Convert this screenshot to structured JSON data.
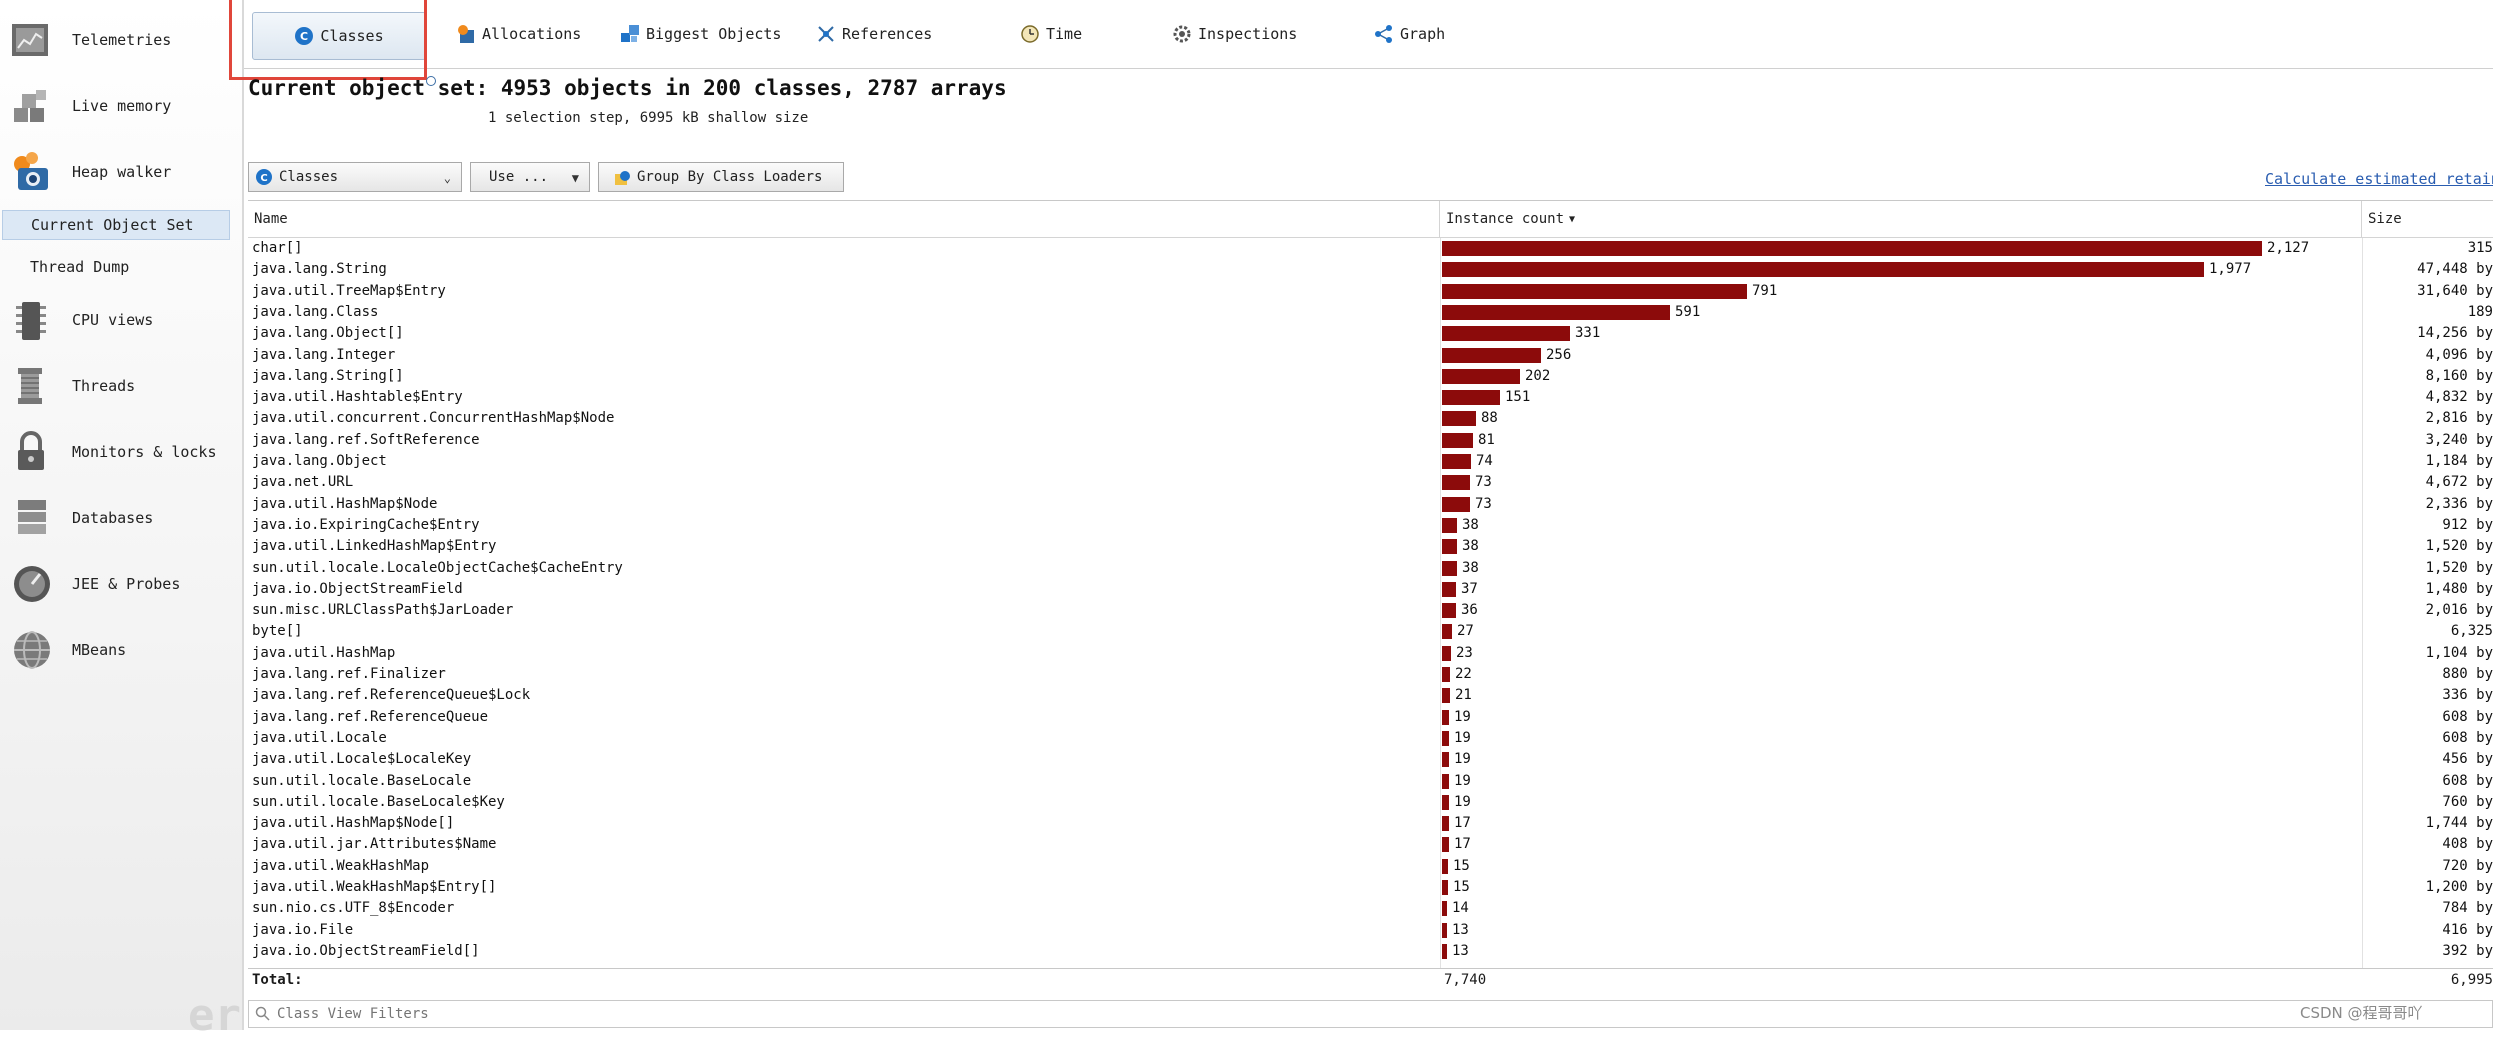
{
  "sidebar": {
    "items": [
      {
        "label": "Telemetries",
        "icon": "telemetries-icon"
      },
      {
        "label": "Live memory",
        "icon": "live-memory-icon"
      },
      {
        "label": "Heap walker",
        "icon": "heap-walker-icon"
      },
      {
        "label": "CPU views",
        "icon": "cpu-views-icon"
      },
      {
        "label": "Threads",
        "icon": "threads-icon"
      },
      {
        "label": "Monitors & locks",
        "icon": "lock-icon"
      },
      {
        "label": "Databases",
        "icon": "database-icon"
      },
      {
        "label": "JEE & Probes",
        "icon": "probe-gauge-icon"
      },
      {
        "label": "MBeans",
        "icon": "globe-icon"
      }
    ],
    "subitems": [
      {
        "label": "Current Object Set",
        "active": true
      },
      {
        "label": "Thread Dump",
        "active": false
      }
    ]
  },
  "tabs": [
    {
      "label": "Classes",
      "icon": "classes-icon",
      "active": true
    },
    {
      "label": "Allocations",
      "icon": "allocations-icon"
    },
    {
      "label": "Biggest Objects",
      "icon": "biggest-objects-icon"
    },
    {
      "label": "References",
      "icon": "references-icon"
    },
    {
      "label": "Time",
      "icon": "clock-icon"
    },
    {
      "label": "Inspections",
      "icon": "gear-icon"
    },
    {
      "label": "Graph",
      "icon": "graph-icon"
    }
  ],
  "header": {
    "title": "Current object set: 4953 objects in 200 classes, 2787 arrays",
    "subtitle": "1 selection step, 6995 kB shallow size"
  },
  "controls": {
    "view_select": "Classes",
    "use_button": "Use ...",
    "group_button": "Group By Class Loaders",
    "calc_link": "Calculate estimated retained"
  },
  "table": {
    "columns": [
      "Name",
      "Instance count",
      "Size"
    ],
    "sort_column": "Instance count",
    "max_count": 2127,
    "rows": [
      {
        "name": "char[]",
        "count": 2127,
        "count_label": "2,127",
        "size": "315"
      },
      {
        "name": "java.lang.String",
        "count": 1977,
        "count_label": "1,977",
        "size": "47,448 by"
      },
      {
        "name": "java.util.TreeMap$Entry",
        "count": 791,
        "count_label": "791",
        "size": "31,640 by"
      },
      {
        "name": "java.lang.Class",
        "count": 591,
        "count_label": "591",
        "size": "189"
      },
      {
        "name": "java.lang.Object[]",
        "count": 331,
        "count_label": "331",
        "size": "14,256 by"
      },
      {
        "name": "java.lang.Integer",
        "count": 256,
        "count_label": "256",
        "size": "4,096 by"
      },
      {
        "name": "java.lang.String[]",
        "count": 202,
        "count_label": "202",
        "size": "8,160 by"
      },
      {
        "name": "java.util.Hashtable$Entry",
        "count": 151,
        "count_label": "151",
        "size": "4,832 by"
      },
      {
        "name": "java.util.concurrent.ConcurrentHashMap$Node",
        "count": 88,
        "count_label": "88",
        "size": "2,816 by"
      },
      {
        "name": "java.lang.ref.SoftReference",
        "count": 81,
        "count_label": "81",
        "size": "3,240 by"
      },
      {
        "name": "java.lang.Object",
        "count": 74,
        "count_label": "74",
        "size": "1,184 by"
      },
      {
        "name": "java.net.URL",
        "count": 73,
        "count_label": "73",
        "size": "4,672 by"
      },
      {
        "name": "java.util.HashMap$Node",
        "count": 73,
        "count_label": "73",
        "size": "2,336 by"
      },
      {
        "name": "java.io.ExpiringCache$Entry",
        "count": 38,
        "count_label": "38",
        "size": "912 by"
      },
      {
        "name": "java.util.LinkedHashMap$Entry",
        "count": 38,
        "count_label": "38",
        "size": "1,520 by"
      },
      {
        "name": "sun.util.locale.LocaleObjectCache$CacheEntry",
        "count": 38,
        "count_label": "38",
        "size": "1,520 by"
      },
      {
        "name": "java.io.ObjectStreamField",
        "count": 37,
        "count_label": "37",
        "size": "1,480 by"
      },
      {
        "name": "sun.misc.URLClassPath$JarLoader",
        "count": 36,
        "count_label": "36",
        "size": "2,016 by"
      },
      {
        "name": "byte[]",
        "count": 27,
        "count_label": "27",
        "size": "6,325"
      },
      {
        "name": "java.util.HashMap",
        "count": 23,
        "count_label": "23",
        "size": "1,104 by"
      },
      {
        "name": "java.lang.ref.Finalizer",
        "count": 22,
        "count_label": "22",
        "size": "880 by"
      },
      {
        "name": "java.lang.ref.ReferenceQueue$Lock",
        "count": 21,
        "count_label": "21",
        "size": "336 by"
      },
      {
        "name": "java.lang.ref.ReferenceQueue",
        "count": 19,
        "count_label": "19",
        "size": "608 by"
      },
      {
        "name": "java.util.Locale",
        "count": 19,
        "count_label": "19",
        "size": "608 by"
      },
      {
        "name": "java.util.Locale$LocaleKey",
        "count": 19,
        "count_label": "19",
        "size": "456 by"
      },
      {
        "name": "sun.util.locale.BaseLocale",
        "count": 19,
        "count_label": "19",
        "size": "608 by"
      },
      {
        "name": "sun.util.locale.BaseLocale$Key",
        "count": 19,
        "count_label": "19",
        "size": "760 by"
      },
      {
        "name": "java.util.HashMap$Node[]",
        "count": 17,
        "count_label": "17",
        "size": "1,744 by"
      },
      {
        "name": "java.util.jar.Attributes$Name",
        "count": 17,
        "count_label": "17",
        "size": "408 by"
      },
      {
        "name": "java.util.WeakHashMap",
        "count": 15,
        "count_label": "15",
        "size": "720 by"
      },
      {
        "name": "java.util.WeakHashMap$Entry[]",
        "count": 15,
        "count_label": "15",
        "size": "1,200 by"
      },
      {
        "name": "sun.nio.cs.UTF_8$Encoder",
        "count": 14,
        "count_label": "14",
        "size": "784 by"
      },
      {
        "name": "java.io.File",
        "count": 13,
        "count_label": "13",
        "size": "416 by"
      },
      {
        "name": "java.io.ObjectStreamField[]",
        "count": 13,
        "count_label": "13",
        "size": "392 by"
      }
    ],
    "total_label": "Total:",
    "total_count": "7,740",
    "total_size": "6,995"
  },
  "filter": {
    "placeholder": "Class View Filters"
  },
  "watermark": "CSDN @程哥哥吖",
  "colors": {
    "bar": "#8c0b0b",
    "link": "#2a5db0",
    "highlight": "#e0463a",
    "accent_blue": "#1f73c8"
  }
}
